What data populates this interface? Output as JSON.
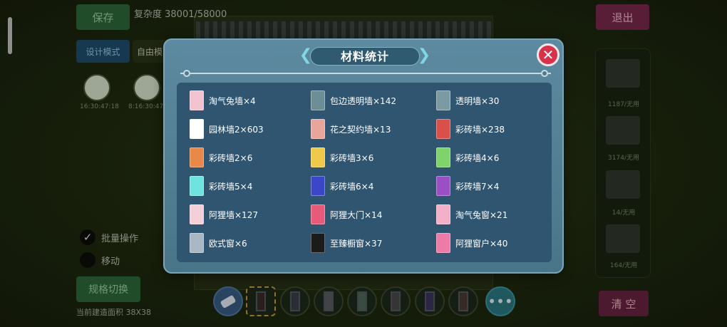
{
  "background": {
    "save_label": "保存",
    "complexity": "复杂度 38001/58000",
    "design_mode_label": "设计模式",
    "free_label": "自由模",
    "exit_label": "退出",
    "batch_label": "批量操作",
    "move_label": "移动",
    "spec_switch_label": "规格切换",
    "area_text": "当前建造面积 38X38",
    "clear_label": "清 空",
    "thumb_labels": [
      "16:30:47:18",
      "8:16:30:47"
    ],
    "right_panel_labels": [
      "1187/无用",
      "3174/无用",
      "14/无用",
      "164/无用"
    ]
  },
  "modal": {
    "title": "材料统计",
    "close_icon": "close-x-icon",
    "items": [
      {
        "label": "淘气兔墙×4",
        "color": "#f2c4cf",
        "icon": "pink-wall-icon"
      },
      {
        "label": "包边透明墙×142",
        "color": "#6c8f96",
        "icon": "framed-glass-wall-icon"
      },
      {
        "label": "透明墙×30",
        "color": "#7b9aa1",
        "icon": "glass-wall-icon"
      },
      {
        "label": "园林墙2×603",
        "color": "#ffffff",
        "icon": "garden-wall-icon"
      },
      {
        "label": "花之契约墙×13",
        "color": "#e8a59a",
        "icon": "flower-wall-icon"
      },
      {
        "label": "彩砖墙×238",
        "color": "#d94f4a",
        "icon": "red-brick-wall-icon"
      },
      {
        "label": "彩砖墙2×6",
        "color": "#e8894a",
        "icon": "orange-brick-wall-icon"
      },
      {
        "label": "彩砖墙3×6",
        "color": "#f0c84a",
        "icon": "yellow-brick-wall-icon"
      },
      {
        "label": "彩砖墙4×6",
        "color": "#7ed36a",
        "icon": "green-brick-wall-icon"
      },
      {
        "label": "彩砖墙5×4",
        "color": "#6fe3e0",
        "icon": "cyan-brick-wall-icon"
      },
      {
        "label": "彩砖墙6×4",
        "color": "#3a47c6",
        "icon": "blue-brick-wall-icon"
      },
      {
        "label": "彩砖墙7×4",
        "color": "#9a4fc4",
        "icon": "purple-brick-wall-icon"
      },
      {
        "label": "阿狸墙×127",
        "color": "#f3cfd8",
        "icon": "ali-wall-icon"
      },
      {
        "label": "阿狸大门×14",
        "color": "#e85a7a",
        "icon": "ali-gate-icon"
      },
      {
        "label": "淘气兔窗×21",
        "color": "#f3b0c8",
        "icon": "rabbit-window-icon"
      },
      {
        "label": "欧式窗×6",
        "color": "#a9b8c4",
        "icon": "european-window-icon"
      },
      {
        "label": "至臻橱窗×37",
        "color": "#1b1b1b",
        "icon": "showcase-window-icon"
      },
      {
        "label": "阿狸窗户×40",
        "color": "#ee7aa8",
        "icon": "ali-window-icon"
      }
    ]
  },
  "toolbar": {
    "more_label": "•••",
    "tools": [
      "eraser-icon",
      "dark-door-icon",
      "gray-door-icon",
      "stone-door-icon",
      "green-door-icon",
      "window-door-icon",
      "purple-door-icon",
      "brown-door-icon"
    ]
  }
}
